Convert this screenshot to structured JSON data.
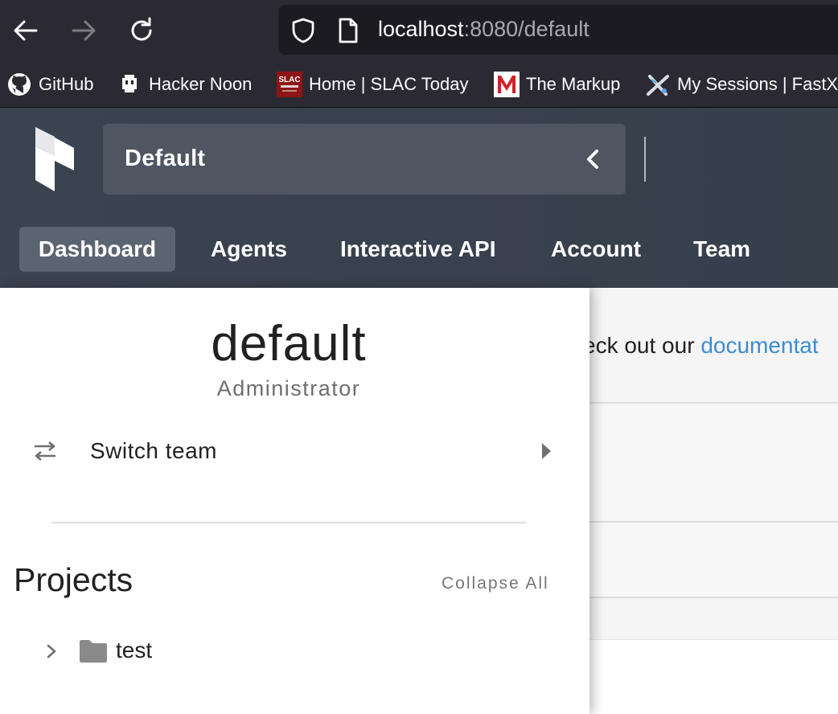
{
  "browser": {
    "url_host": "localhost",
    "url_path": ":8080/default",
    "bookmarks": [
      {
        "label": "GitHub",
        "icon": "github-icon"
      },
      {
        "label": "Hacker Noon",
        "icon": "hacker-noon-icon"
      },
      {
        "label": "Home | SLAC Today",
        "icon": "slac-today-icon"
      },
      {
        "label": "The Markup",
        "icon": "the-markup-icon"
      },
      {
        "label": "My Sessions | FastX",
        "icon": "fastx-icon"
      }
    ],
    "slac_favicon_text": "SLAC"
  },
  "header": {
    "team_name": "Default",
    "tabs": [
      {
        "label": "Dashboard",
        "active": true
      },
      {
        "label": "Agents",
        "active": false
      },
      {
        "label": "Interactive API",
        "active": false
      },
      {
        "label": "Account",
        "active": false
      },
      {
        "label": "Team",
        "active": false
      }
    ]
  },
  "drawer": {
    "user_name": "default",
    "role": "Administrator",
    "switch_team_label": "Switch team",
    "projects_title": "Projects",
    "collapse_all_label": "Collapse All",
    "projects": [
      {
        "name": "test"
      }
    ]
  },
  "main": {
    "doc_prefix": "eck out our ",
    "doc_link": "documentat"
  },
  "colors": {
    "header_bg": "#3a4350",
    "active_tab_bg": "#5b6571",
    "link": "#3b8dd6",
    "browser_chrome": "#2b2a33"
  }
}
